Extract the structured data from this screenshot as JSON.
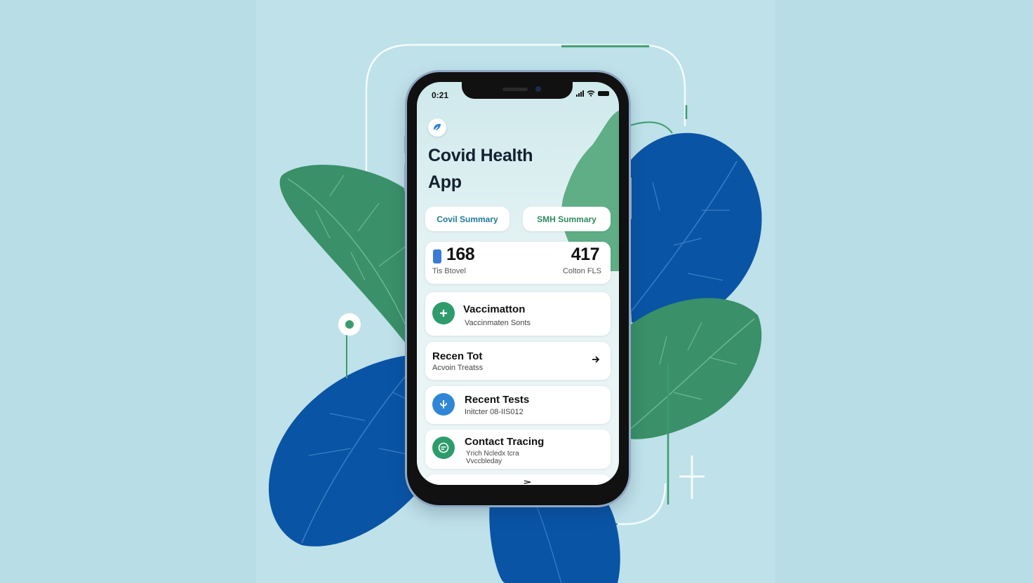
{
  "status_bar": {
    "time": "0:21",
    "icons": [
      "signal-icon",
      "wifi-icon",
      "battery-icon"
    ]
  },
  "app": {
    "logo_icon": "leaf-logo-icon",
    "title_line1": "Covid Health",
    "title_line2": "App"
  },
  "summary_tabs": [
    {
      "label": "Covil Summary"
    },
    {
      "label": "SMH Summary"
    }
  ],
  "stats": {
    "left_icon": "vial-icon",
    "left_value": "168",
    "left_label": "Tis Btovel",
    "right_value": "417",
    "right_label": "Colton FLS"
  },
  "cards": {
    "vaccination": {
      "icon": "plus-icon",
      "title": "Vaccimatton",
      "subtitle": "Vaccinmaten Sonts"
    },
    "recent_tot": {
      "title": "Recen Tot",
      "subtitle": "Acvoin Treatss",
      "action_icon": "arrow-right-icon"
    },
    "recent_tests": {
      "icon": "test-icon",
      "title": "Recent Tests",
      "subtitle": "Initcter 08-IIS012"
    },
    "contact_tracing": {
      "icon": "tracing-icon",
      "title": "Contact Tracing",
      "subtitle_line1": "Yrich Ncledx tcra",
      "subtitle_line2": "Vvccbleday"
    }
  },
  "colors": {
    "background": "#b9dde6",
    "leaf_green": "#3a9068",
    "leaf_blue": "#0a54a6",
    "accent_green": "#2e9b6b",
    "accent_blue": "#2f86d6",
    "phone_frame": "#111111"
  }
}
